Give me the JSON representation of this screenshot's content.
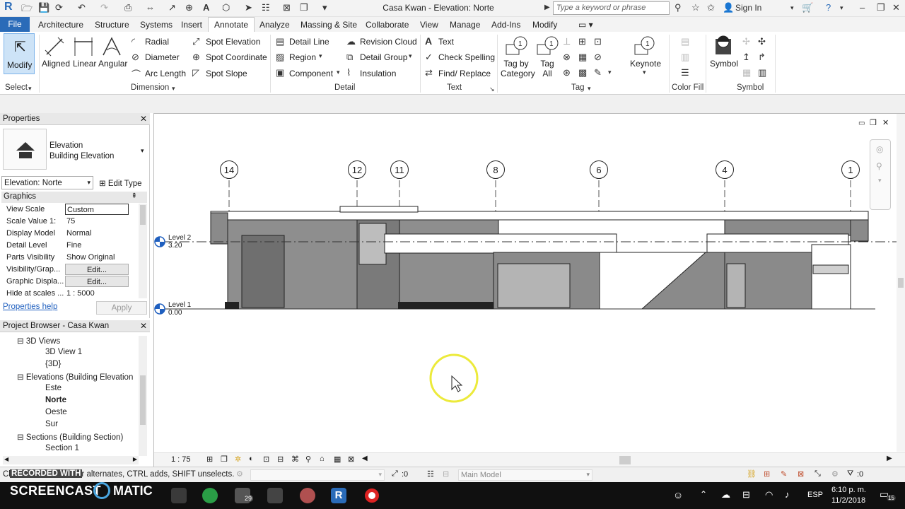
{
  "titlebar": {
    "app_title": "Casa Kwan - Elevation: Norte",
    "search_placeholder": "Type a keyword or phrase",
    "sign_in": "Sign In"
  },
  "tabs": [
    "File",
    "Architecture",
    "Structure",
    "Systems",
    "Insert",
    "Annotate",
    "Analyze",
    "Massing & Site",
    "Collaborate",
    "View",
    "Manage",
    "Add-Ins",
    "Modify"
  ],
  "active_tab": "Annotate",
  "ribbon": {
    "modify": "Modify",
    "select_panel": "Select",
    "dimension": {
      "aligned": "Aligned",
      "linear": "Linear",
      "angular": "Angular",
      "radial": "Radial",
      "diameter": "Diameter",
      "arc_length": "Arc  Length",
      "spot_elevation": "Spot  Elevation",
      "spot_coordinate": "Spot  Coordinate",
      "spot_slope": "Spot  Slope",
      "panel": "Dimension"
    },
    "detail": {
      "detail_line": "Detail  Line",
      "region": "Region",
      "component": "Component",
      "revision_cloud": "Revision  Cloud",
      "detail_group": "Detail  Group",
      "insulation": "Insulation",
      "panel": "Detail"
    },
    "text": {
      "text": "Text",
      "check_spelling": "Check  Spelling",
      "find_replace": "Find/  Replace",
      "panel": "Text"
    },
    "tag": {
      "tag_by_category": "Tag by Category",
      "tag_all": "Tag All",
      "keynote": "Keynote",
      "panel": "Tag"
    },
    "color_fill": "Color Fill",
    "symbol": {
      "symbol": "Symbol",
      "panel": "Symbol"
    }
  },
  "properties": {
    "title": "Properties",
    "type_line1": "Elevation",
    "type_line2": "Building Elevation",
    "selector": "Elevation: Norte",
    "edit_type": "Edit Type",
    "group": "Graphics",
    "rows": [
      {
        "k": "View Scale",
        "v": "Custom"
      },
      {
        "k": "Scale Value    1:",
        "v": "75"
      },
      {
        "k": "Display Model",
        "v": "Normal"
      },
      {
        "k": "Detail Level",
        "v": "Fine"
      },
      {
        "k": "Parts Visibility",
        "v": "Show Original"
      },
      {
        "k": "Visibility/Grap...",
        "v": "Edit..."
      },
      {
        "k": "Graphic Displa...",
        "v": "Edit..."
      },
      {
        "k": "Hide at scales ...",
        "v": "1 : 5000"
      }
    ],
    "help": "Properties help",
    "apply": "Apply"
  },
  "browser": {
    "title": "Project Browser - Casa Kwan",
    "items": [
      {
        "label": "3D Views"
      },
      {
        "label": "3D View 1"
      },
      {
        "label": "{3D}"
      },
      {
        "label": "Elevations (Building Elevation"
      },
      {
        "label": "Este"
      },
      {
        "label": "Norte"
      },
      {
        "label": "Oeste"
      },
      {
        "label": "Sur"
      },
      {
        "label": "Sections (Building Section)"
      },
      {
        "label": "Section 1"
      }
    ]
  },
  "canvas": {
    "grids": [
      "14",
      "12",
      "11",
      "8",
      "6",
      "4",
      "1"
    ],
    "level2_name": "Level 2",
    "level2_value": "3.20",
    "level1_name": "Level 1",
    "level1_value": "0.00",
    "scale": "1 : 75"
  },
  "status": {
    "hint": "Click to select, TAB for alternates, CTRL adds, SHIFT unselects.",
    "overlay": "RECORDED WITH",
    "zero": ":0",
    "model": "Main Model",
    "filter": ":0"
  },
  "taskbar": {
    "brand": "SCREENCAST",
    "brand2": "MATIC",
    "mail_badge": "29",
    "lang": "ESP",
    "time": "6:10 p. m.",
    "date": "11/2/2018",
    "notif": "15"
  }
}
